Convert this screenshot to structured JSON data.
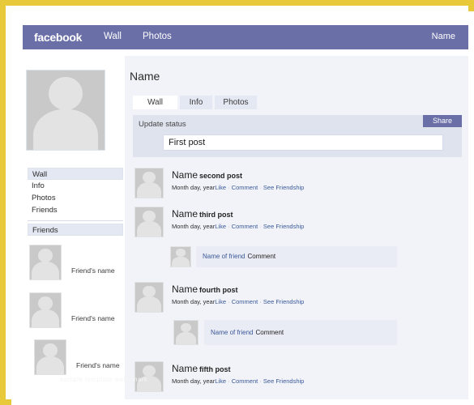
{
  "navbar": {
    "brand": "facebook",
    "links": [
      {
        "label": "Wall"
      },
      {
        "label": "Photos"
      }
    ],
    "account_name": "Name"
  },
  "profile": {
    "name": "Name",
    "photo_icon": "user-placeholder-icon"
  },
  "tabs": [
    {
      "label": "Wall",
      "active": true
    },
    {
      "label": "Info",
      "active": false
    },
    {
      "label": "Photos",
      "active": false
    }
  ],
  "status_composer": {
    "label": "Update status",
    "share_label": "Share",
    "input_value": "First post",
    "input_placeholder": "First post"
  },
  "sidebar": {
    "nav_items": [
      {
        "label": "Wall",
        "active": true
      },
      {
        "label": "Info",
        "active": false
      },
      {
        "label": "Photos",
        "active": false
      },
      {
        "label": "Friends",
        "active": false
      }
    ],
    "friends_header": "Friends",
    "friends": [
      {
        "name": "Friend's name",
        "photo_icon": "user-placeholder-icon"
      },
      {
        "name": "Friend's name",
        "photo_icon": "user-placeholder-icon"
      },
      {
        "name": "Friend's name",
        "photo_icon": "user-placeholder-icon"
      }
    ]
  },
  "feed": {
    "posts": [
      {
        "author": "Name",
        "text": "second post",
        "date": "Month day, year",
        "actions": [
          "Like",
          "Comment",
          "See Friendship"
        ],
        "photo_icon": "user-placeholder-icon"
      },
      {
        "author": "Name",
        "text": "third post",
        "date": "Month day, year",
        "actions": [
          "Like",
          "Comment",
          "See Friendship"
        ],
        "photo_icon": "user-placeholder-icon"
      },
      {
        "author": "Name",
        "text": "fourth post",
        "date": "Month day, year",
        "actions": [
          "Like",
          "Comment",
          "See Friendship"
        ],
        "photo_icon": "user-placeholder-icon"
      },
      {
        "author": "Name",
        "text": "fifth post",
        "date": "Month day, year",
        "actions": [
          "Like",
          "Comment",
          "See Friendship"
        ],
        "photo_icon": "user-placeholder-icon"
      }
    ],
    "comments": [
      {
        "author": "Name of friend",
        "text": "Comment",
        "photo_icon": "user-placeholder-icon"
      },
      {
        "author": "Name of friend",
        "text": "Comment",
        "photo_icon": "user-placeholder-icon"
      }
    ],
    "action_separator": "·"
  },
  "watermark": "sample template watermark",
  "colors": {
    "brand_purple": "#6a6fa8",
    "frame_yellow": "#e8c93a",
    "panel_blue": "#f1f3f9",
    "link_blue": "#3b5998",
    "composer_grey": "#dfe3ee"
  }
}
